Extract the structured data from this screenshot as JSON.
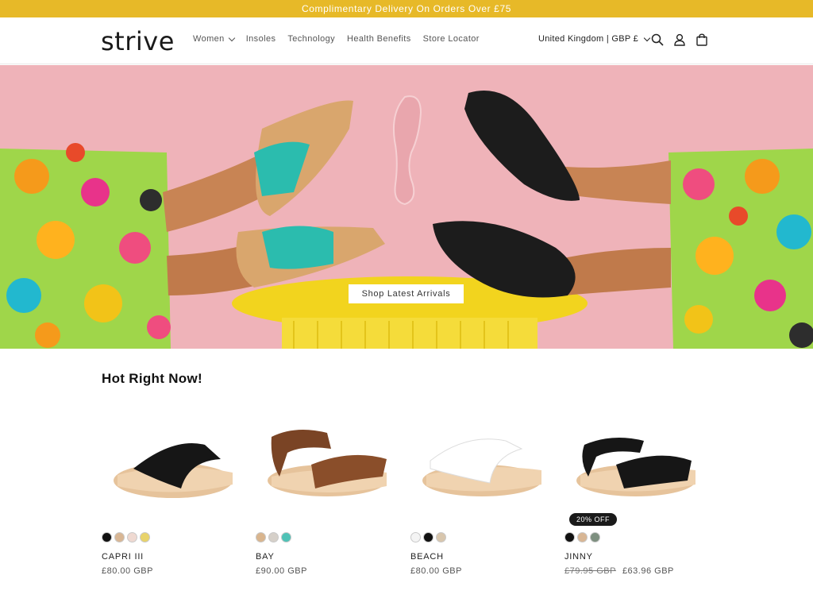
{
  "announcement": {
    "text": "Complimentary Delivery On Orders Over £75"
  },
  "header": {
    "logo_text": "strive",
    "nav": [
      {
        "label": "Women",
        "has_dropdown": true
      },
      {
        "label": "Insoles"
      },
      {
        "label": "Technology"
      },
      {
        "label": "Health Benefits"
      },
      {
        "label": "Store Locator"
      }
    ],
    "locale": "United Kingdom | GBP £",
    "icons": [
      "search-icon",
      "account-icon",
      "cart-icon"
    ]
  },
  "hero": {
    "button_label": "Shop Latest Arrivals"
  },
  "section": {
    "title": "Hot Right Now!"
  },
  "products": [
    {
      "name": "CAPRI III",
      "price": "£80.00 GBP",
      "swatches": [
        "#111111",
        "#d8b694",
        "#efd9d1",
        "#e8d36b"
      ]
    },
    {
      "name": "BAY",
      "price": "£90.00 GBP",
      "swatches": [
        "#d9b58e",
        "#d6d0c9",
        "#4fc2b6"
      ]
    },
    {
      "name": "BEACH",
      "price": "£80.00 GBP",
      "swatches": [
        "#f4f4f4",
        "#111111",
        "#d8c6ad"
      ]
    },
    {
      "name": "JINNY",
      "old_price": "£79.95 GBP",
      "price": "£63.96 GBP",
      "badge": "20% OFF",
      "swatches": [
        "#111111",
        "#d8b694",
        "#7d8f7f"
      ]
    }
  ],
  "colors": {
    "announcement_bar": "#e7b928",
    "hero_background": "#efb3b9"
  }
}
